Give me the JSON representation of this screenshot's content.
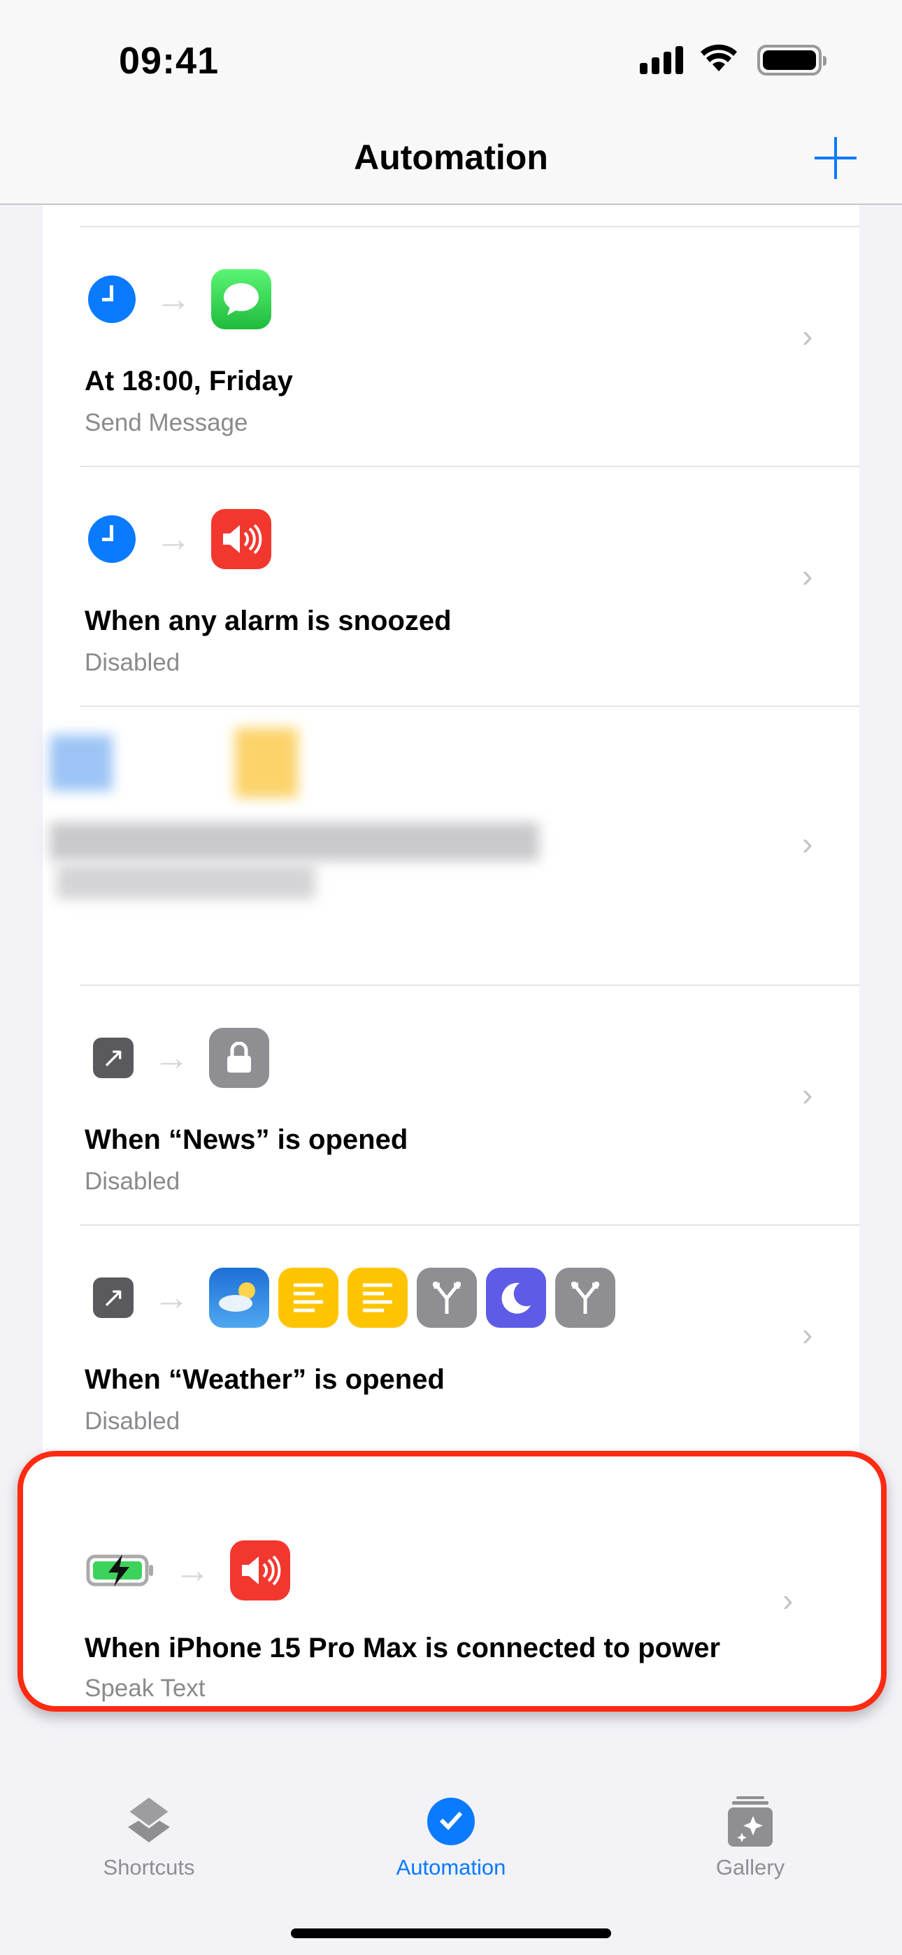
{
  "status_bar": {
    "time": "09:41"
  },
  "nav": {
    "title": "Automation",
    "add_icon": "plus-icon"
  },
  "automations": [
    {
      "trigger_icon": "clock-icon",
      "actions": [
        "messages-app-icon"
      ],
      "title": "At 18:00, Friday",
      "subtitle": "Send Message"
    },
    {
      "trigger_icon": "clock-icon",
      "actions": [
        "speak-text-icon"
      ],
      "title": "When any alarm is snoozed",
      "subtitle": "Disabled"
    },
    {
      "redacted": true
    },
    {
      "trigger_icon": "app-open-icon",
      "actions": [
        "lock-icon"
      ],
      "title": "When “News” is opened",
      "subtitle": "Disabled"
    },
    {
      "trigger_icon": "app-open-icon",
      "actions": [
        "weather-app-icon",
        "text-icon",
        "text-icon",
        "if-branch-icon",
        "focus-moon-icon",
        "if-branch-icon"
      ],
      "title": "When “Weather” is opened",
      "subtitle": "Disabled"
    },
    {
      "trigger_icon": "charging-battery-icon",
      "actions": [
        "speak-text-icon"
      ],
      "title": "When iPhone 15 Pro Max is connected to power",
      "subtitle": "Speak Text",
      "highlighted": true
    }
  ],
  "tabs": [
    {
      "label": "Shortcuts",
      "icon": "layers-icon"
    },
    {
      "label": "Automation",
      "icon": "automation-check-icon",
      "active": true
    },
    {
      "label": "Gallery",
      "icon": "gallery-sparkle-icon"
    }
  ],
  "colors": {
    "accent": "#0a7aff",
    "highlight": "#ff2a12",
    "speak": "#f2372f",
    "messages": "#2fc94a",
    "text": "#fec400",
    "focus": "#5e5ce6",
    "gray": "#8e8e93"
  }
}
